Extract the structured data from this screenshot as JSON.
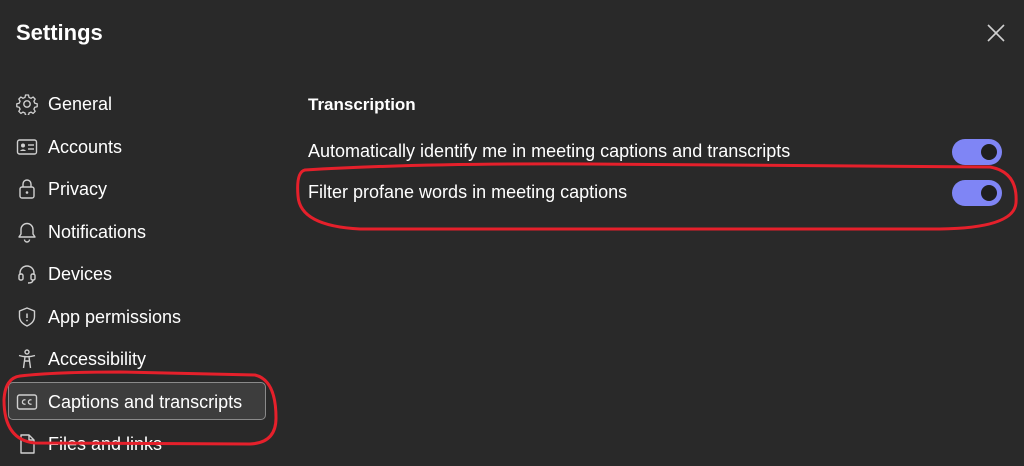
{
  "dialog": {
    "title": "Settings",
    "close_icon": "close-icon"
  },
  "sidebar": {
    "items": [
      {
        "label": "General",
        "icon": "gear-icon"
      },
      {
        "label": "Accounts",
        "icon": "id-card-icon"
      },
      {
        "label": "Privacy",
        "icon": "lock-icon"
      },
      {
        "label": "Notifications",
        "icon": "bell-icon"
      },
      {
        "label": "Devices",
        "icon": "headset-icon"
      },
      {
        "label": "App permissions",
        "icon": "shield-icon"
      },
      {
        "label": "Accessibility",
        "icon": "accessibility-icon"
      },
      {
        "label": "Captions and transcripts",
        "icon": "cc-icon",
        "selected": true
      },
      {
        "label": "Files and links",
        "icon": "file-icon"
      }
    ]
  },
  "main": {
    "section_title": "Transcription",
    "settings": [
      {
        "label": "Automatically identify me in meeting captions and transcripts",
        "enabled": true
      },
      {
        "label": "Filter profane words in meeting captions",
        "enabled": true
      }
    ]
  },
  "annotations": {
    "color": "#e5202b",
    "highlighted": [
      "sidebar-item-captions-and-transcripts",
      "setting-filter-profane-words"
    ]
  },
  "colors": {
    "background": "#292929",
    "toggle_on": "#7f85f5",
    "selected_item": "#3d3d3d"
  }
}
